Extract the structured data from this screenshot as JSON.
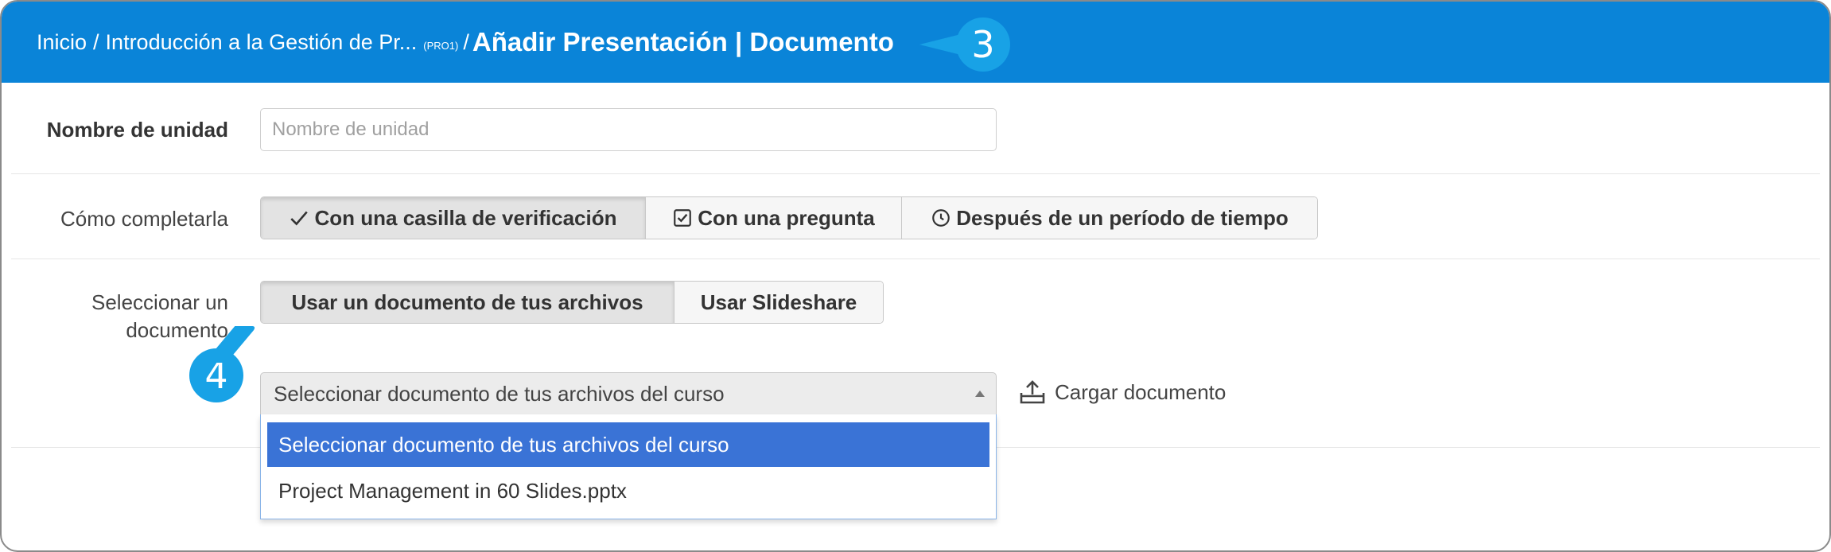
{
  "header": {
    "breadcrumb": {
      "home": "Inicio",
      "separator": "/",
      "course": "Introducción a la Gestión de Pr...",
      "course_code": "(PRO1)",
      "current": "Añadir Presentación | Documento"
    }
  },
  "callouts": {
    "step3": "3",
    "step4": "4"
  },
  "form": {
    "unit_name": {
      "label": "Nombre de unidad",
      "placeholder": "Nombre de unidad",
      "value": ""
    },
    "completion": {
      "label": "Cómo completarla",
      "options": [
        {
          "label": "Con una casilla de verificación",
          "icon": "check-icon",
          "active": true
        },
        {
          "label": "Con una pregunta",
          "icon": "checkbox-icon",
          "active": false
        },
        {
          "label": "Después de un período de tiempo",
          "icon": "clock-icon",
          "active": false
        }
      ]
    },
    "document": {
      "label_line1": "Seleccionar un",
      "label_line2": "documento",
      "sources": [
        {
          "label": "Usar un documento de tus archivos",
          "active": true
        },
        {
          "label": "Usar Slideshare",
          "active": false
        }
      ],
      "select": {
        "value": "Seleccionar documento de tus archivos del curso",
        "options": [
          "Seleccionar documento de tus archivos del curso",
          "Project Management in 60 Slides.pptx"
        ]
      },
      "upload_label": "Cargar documento",
      "upload_icon": "upload-icon"
    }
  },
  "colors": {
    "header_bg": "#0a84d8",
    "callout": "#18a2e6",
    "selected_option": "#3a73d6"
  }
}
